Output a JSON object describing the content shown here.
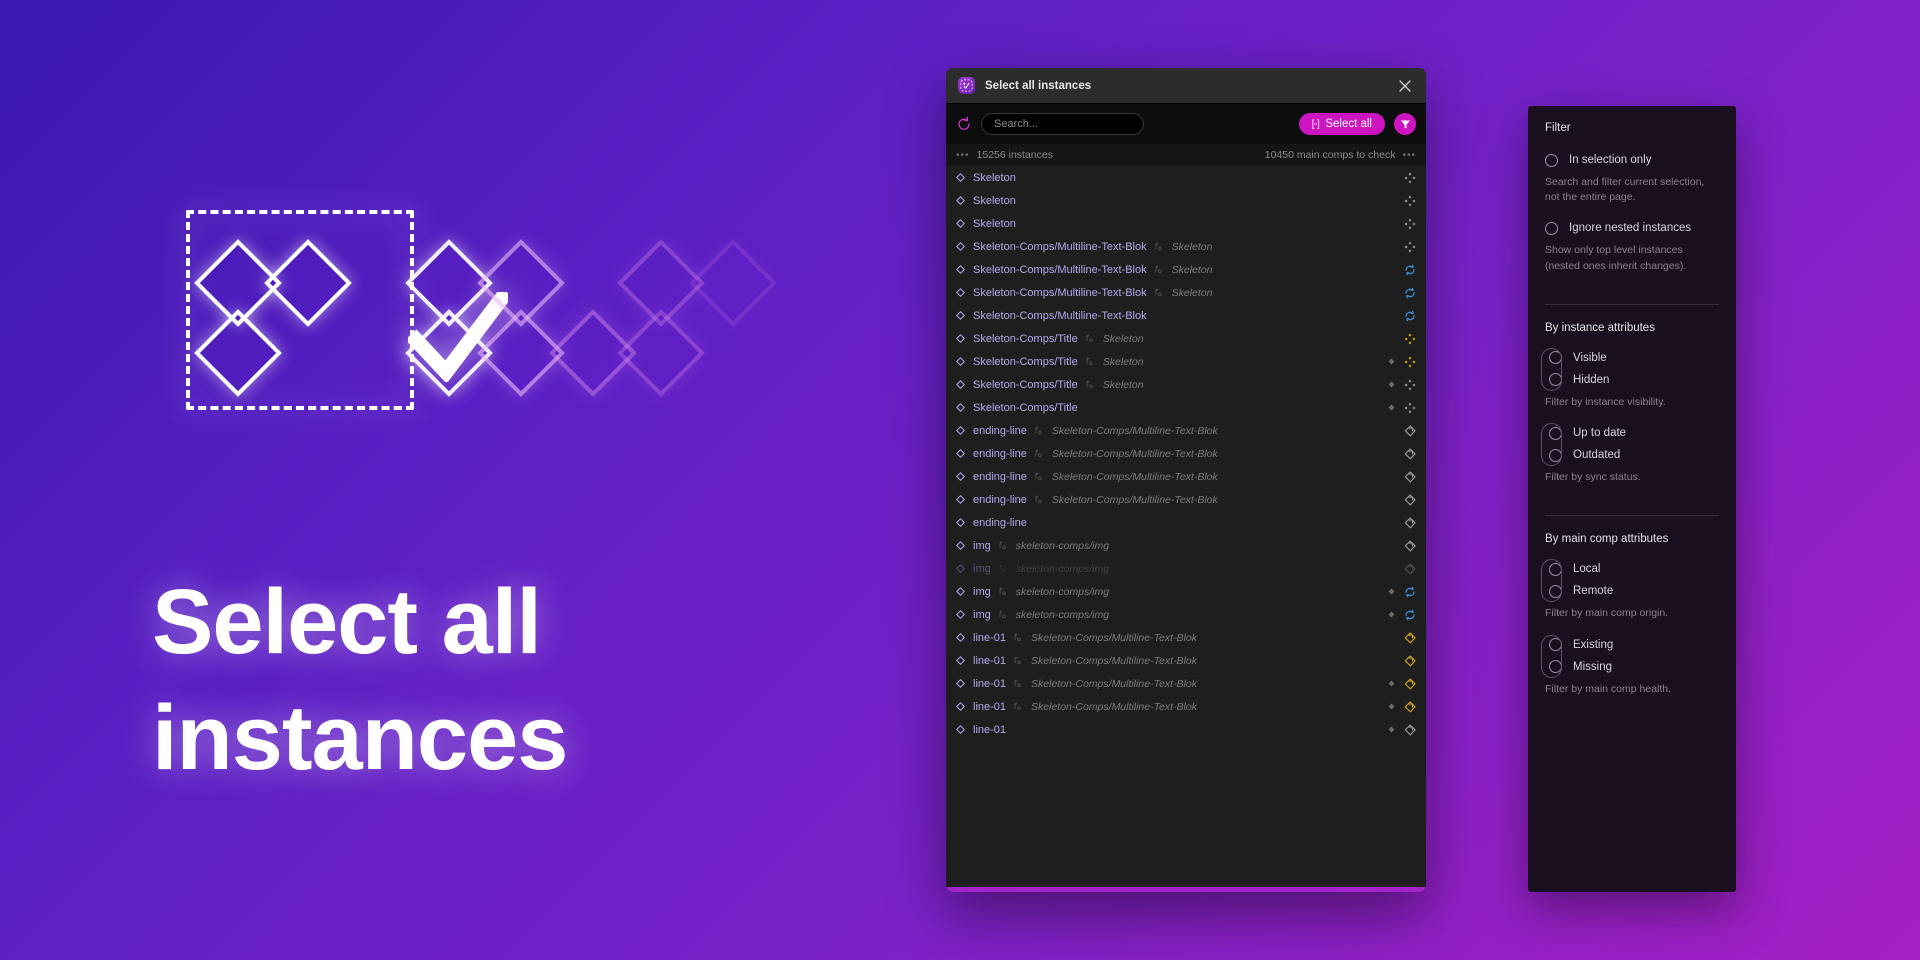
{
  "hero": {
    "title": "Select all instances",
    "artwork_name": "select-all-instances-illustration"
  },
  "dialog": {
    "titlebar": {
      "app_title": "Select all instances",
      "close_label": "×"
    },
    "toolbar": {
      "refresh_label": "refresh",
      "search_placeholder": "Search...",
      "search_value": "",
      "select_all_label": "Select all",
      "select_all_icon_text": "[◦]",
      "filter_label": "filter"
    },
    "stats": {
      "left_dots": "•••",
      "instances": "15256 instances",
      "main_comps": "10450 main comps to check",
      "right_dots": "•••"
    },
    "colors": {
      "accent": "#cc14c1",
      "bottom_bar": "#a324c6",
      "row_name": "#b8a7ea",
      "row_main": "#7d7d7d",
      "status_blue": "#3d8fd6",
      "status_yellow": "#d6a400",
      "status_gold": "#c9a227",
      "status_gray": "#9a9a9a"
    },
    "rows": [
      {
        "name": "Skeleton",
        "main": "",
        "status": "swap",
        "status_color": "gray",
        "mini": false,
        "dim": false
      },
      {
        "name": "Skeleton",
        "main": "",
        "status": "swap",
        "status_color": "gray",
        "mini": false,
        "dim": false
      },
      {
        "name": "Skeleton",
        "main": "",
        "status": "swap",
        "status_color": "gray",
        "mini": false,
        "dim": false
      },
      {
        "name": "Skeleton-Comps/Multiline-Text-Blok",
        "main": "Skeleton",
        "status": "swap",
        "status_color": "gray",
        "mini": false,
        "dim": false
      },
      {
        "name": "Skeleton-Comps/Multiline-Text-Blok",
        "main": "Skeleton",
        "status": "sync",
        "status_color": "blue",
        "mini": false,
        "dim": false
      },
      {
        "name": "Skeleton-Comps/Multiline-Text-Blok",
        "main": "Skeleton",
        "status": "sync",
        "status_color": "blue",
        "mini": false,
        "dim": false
      },
      {
        "name": "Skeleton-Comps/Multiline-Text-Blok",
        "main": "",
        "status": "sync",
        "status_color": "blue",
        "mini": false,
        "dim": false
      },
      {
        "name": "Skeleton-Comps/Title",
        "main": "Skeleton",
        "status": "swap",
        "status_color": "yellow",
        "mini": false,
        "dim": false
      },
      {
        "name": "Skeleton-Comps/Title",
        "main": "Skeleton",
        "status": "swap",
        "status_color": "yellow",
        "mini": true,
        "dim": false
      },
      {
        "name": "Skeleton-Comps/Title",
        "main": "Skeleton",
        "status": "swap",
        "status_color": "gray",
        "mini": true,
        "dim": false
      },
      {
        "name": "Skeleton-Comps/Title",
        "main": "",
        "status": "swap",
        "status_color": "gray",
        "mini": true,
        "dim": false
      },
      {
        "name": "ending-line",
        "main": "Skeleton-Comps/Multiline-Text-Blok",
        "status": "tag",
        "status_color": "gray",
        "mini": false,
        "dim": false
      },
      {
        "name": "ending-line",
        "main": "Skeleton-Comps/Multiline-Text-Blok",
        "status": "tag",
        "status_color": "gray",
        "mini": false,
        "dim": false
      },
      {
        "name": "ending-line",
        "main": "Skeleton-Comps/Multiline-Text-Blok",
        "status": "tag",
        "status_color": "gray",
        "mini": false,
        "dim": false
      },
      {
        "name": "ending-line",
        "main": "Skeleton-Comps/Multiline-Text-Blok",
        "status": "tag",
        "status_color": "gray",
        "mini": false,
        "dim": false
      },
      {
        "name": "ending-line",
        "main": "",
        "status": "tag",
        "status_color": "gray",
        "mini": false,
        "dim": false
      },
      {
        "name": "img",
        "main": "skeleton-comps/img",
        "status": "tag",
        "status_color": "gray",
        "mini": false,
        "dim": false
      },
      {
        "name": "img",
        "main": "skeleton-comps/img",
        "status": "tag",
        "status_color": "gray",
        "mini": false,
        "dim": true
      },
      {
        "name": "img",
        "main": "skeleton-comps/img",
        "status": "sync",
        "status_color": "blue",
        "mini": true,
        "dim": false
      },
      {
        "name": "img",
        "main": "skeleton-comps/img",
        "status": "sync",
        "status_color": "blue",
        "mini": true,
        "dim": false
      },
      {
        "name": "line-01",
        "main": "Skeleton-Comps/Multiline-Text-Blok",
        "status": "tag",
        "status_color": "gold",
        "mini": false,
        "dim": false
      },
      {
        "name": "line-01",
        "main": "Skeleton-Comps/Multiline-Text-Blok",
        "status": "tag",
        "status_color": "gold",
        "mini": false,
        "dim": false
      },
      {
        "name": "line-01",
        "main": "Skeleton-Comps/Multiline-Text-Blok",
        "status": "tag",
        "status_color": "gold",
        "mini": true,
        "dim": false
      },
      {
        "name": "line-01",
        "main": "Skeleton-Comps/Multiline-Text-Blok",
        "status": "tag",
        "status_color": "gold",
        "mini": true,
        "dim": false
      },
      {
        "name": "line-01",
        "main": "",
        "status": "tag",
        "status_color": "gray",
        "mini": true,
        "dim": false
      }
    ]
  },
  "filter_panel": {
    "title": "Filter",
    "toggles": [
      {
        "label": "In selection only",
        "help": "Search and filter current selection, not the entire page."
      },
      {
        "label": "Ignore nested instances",
        "help": "Show only top level instances (nested ones inherit changes)."
      }
    ],
    "sections": [
      {
        "heading": "By instance attributes",
        "groups": [
          {
            "options": [
              "Visible",
              "Hidden"
            ],
            "help": "Filter by instance visibility."
          },
          {
            "options": [
              "Up to date",
              "Outdated"
            ],
            "help": "Filter by sync status."
          }
        ]
      },
      {
        "heading": "By main comp attributes",
        "groups": [
          {
            "options": [
              "Local",
              "Remote"
            ],
            "help": "Filter by main comp origin."
          },
          {
            "options": [
              "Existing",
              "Missing"
            ],
            "help": "Filter by main comp health."
          }
        ]
      }
    ]
  }
}
